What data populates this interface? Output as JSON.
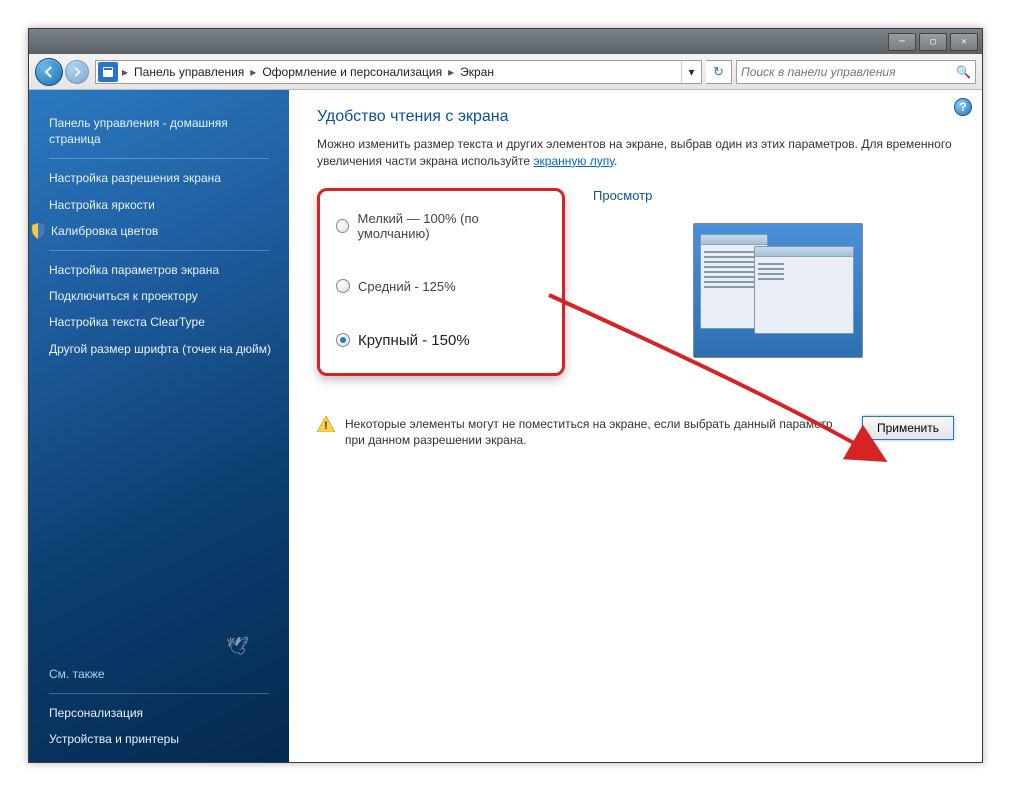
{
  "breadcrumb": {
    "item1": "Панель управления",
    "item2": "Оформление и персонализация",
    "item3": "Экран"
  },
  "search": {
    "placeholder": "Поиск в панели управления"
  },
  "sidebar": {
    "home": "Панель управления - домашняя страница",
    "items": {
      "resolution": "Настройка разрешения экрана",
      "brightness": "Настройка яркости",
      "calibration": "Калибровка цветов",
      "display_settings": "Настройка параметров экрана",
      "projector": "Подключиться к проектору",
      "cleartype": "Настройка текста ClearType",
      "custom_dpi": "Другой размер шрифта (точек на дюйм)"
    },
    "see_also_label": "См. также",
    "see_also": {
      "personalization": "Персонализация",
      "devices": "Устройства и принтеры"
    }
  },
  "main": {
    "title": "Удобство чтения с экрана",
    "desc_part1": "Можно изменить размер текста и других элементов на экране, выбрав один из этих параметров. Для временного увеличения части экрана используйте ",
    "desc_link": "экранную лупу",
    "options": {
      "small": "Мелкий — 100% (по умолчанию)",
      "medium": "Средний - 125%",
      "large": "Крупный - 150%"
    },
    "preview_label": "Просмотр",
    "warning": "Некоторые элементы могут не поместиться на экране, если выбрать данный параметр при данном разрешении экрана.",
    "apply": "Применить"
  }
}
